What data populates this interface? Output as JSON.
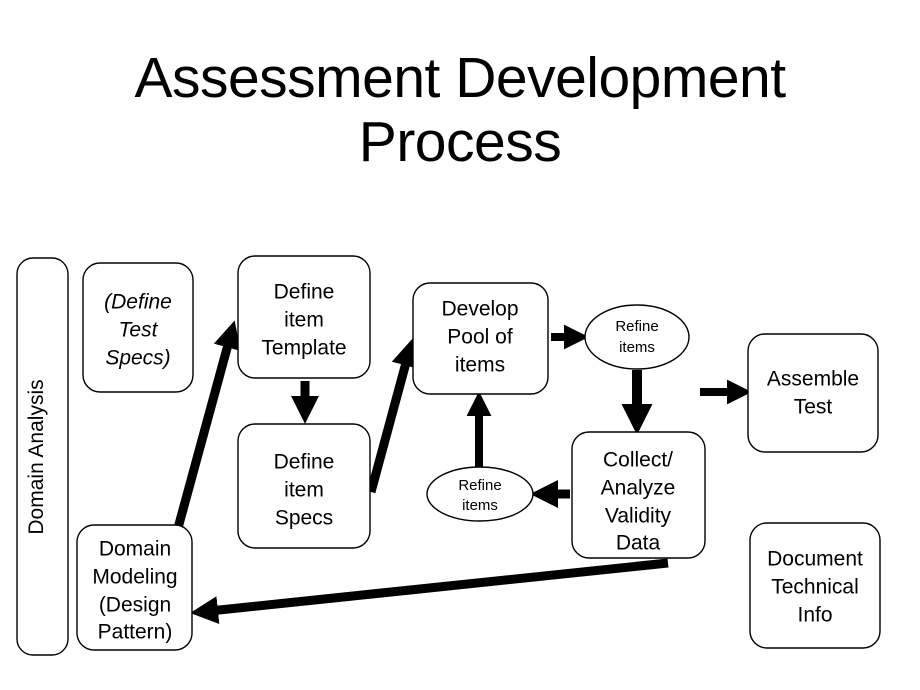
{
  "slide": {
    "background_color": "#ffffff",
    "ink_color": "#000000",
    "title": {
      "line1": "Assessment Development",
      "line2": "Process",
      "full": "Assessment Development Process"
    }
  },
  "diagram": {
    "type": "flowchart",
    "phase_bar": {
      "label": "Domain Analysis",
      "orientation": "vertical",
      "shape": "rounded-rect"
    },
    "nodes": [
      {
        "id": "define-test-specs",
        "shape": "rounded-rect",
        "style": "italic",
        "lines": [
          "(Define",
          "Test",
          "Specs)"
        ]
      },
      {
        "id": "domain-modeling",
        "shape": "rounded-rect",
        "style": "normal",
        "lines": [
          "Domain",
          "Modeling",
          "(Design",
          "Pattern)"
        ]
      },
      {
        "id": "define-item-template",
        "shape": "rounded-rect",
        "style": "normal",
        "lines": [
          "Define",
          "item",
          "Template"
        ]
      },
      {
        "id": "define-item-specs",
        "shape": "rounded-rect",
        "style": "normal",
        "lines": [
          "Define",
          "item",
          "Specs"
        ]
      },
      {
        "id": "develop-pool-of-items",
        "shape": "rounded-rect",
        "style": "normal",
        "lines": [
          "Develop",
          "Pool of",
          "items"
        ]
      },
      {
        "id": "refine-items-top",
        "shape": "ellipse",
        "style": "normal",
        "lines": [
          "Refine",
          "items"
        ]
      },
      {
        "id": "refine-items-bottom",
        "shape": "ellipse",
        "style": "normal",
        "lines": [
          "Refine",
          "items"
        ]
      },
      {
        "id": "collect-analyze-validity-data",
        "shape": "rounded-rect",
        "style": "normal",
        "lines": [
          "Collect/",
          "Analyze",
          "Validity",
          "Data"
        ]
      },
      {
        "id": "assemble-test",
        "shape": "rounded-rect",
        "style": "normal",
        "lines": [
          "Assemble",
          "Test"
        ]
      },
      {
        "id": "document-technical-info",
        "shape": "rounded-rect",
        "style": "normal",
        "lines": [
          "Document",
          "Technical",
          "Info"
        ]
      }
    ],
    "edges": [
      {
        "id": "domain-modeling-to-define-item-template",
        "from": "domain-modeling",
        "to": "define-item-template"
      },
      {
        "id": "define-item-template-to-define-item-specs",
        "from": "define-item-template",
        "to": "define-item-specs"
      },
      {
        "id": "define-item-specs-to-develop-pool",
        "from": "define-item-specs",
        "to": "develop-pool-of-items"
      },
      {
        "id": "develop-pool-to-refine-items-top",
        "from": "develop-pool-of-items",
        "to": "refine-items-top"
      },
      {
        "id": "refine-items-top-to-collect-analyze",
        "from": "refine-items-top",
        "to": "collect-analyze-validity-data"
      },
      {
        "id": "collect-analyze-to-refine-items-bottom",
        "from": "collect-analyze-validity-data",
        "to": "refine-items-bottom"
      },
      {
        "id": "refine-items-bottom-to-develop-pool",
        "from": "refine-items-bottom",
        "to": "develop-pool-of-items"
      },
      {
        "id": "collect-analyze-to-assemble-test",
        "from": "collect-analyze-validity-data",
        "to": "assemble-test"
      },
      {
        "id": "collect-analyze-to-domain-modeling",
        "from": "collect-analyze-validity-data",
        "to": "domain-modeling"
      }
    ]
  }
}
